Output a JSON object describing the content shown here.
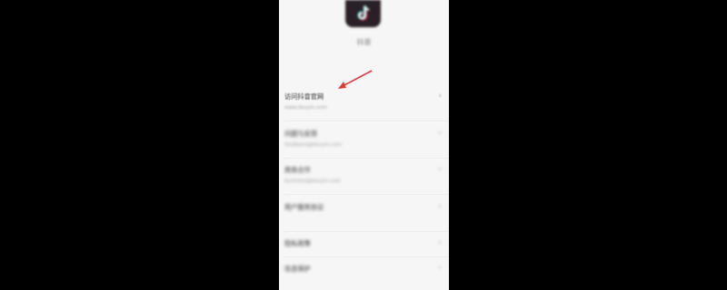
{
  "app": {
    "name": "抖音",
    "logo_icon": "tiktok-note-icon",
    "accent": "#e23a3a"
  },
  "menu": {
    "items": [
      {
        "title": "访问抖音官网",
        "sub": "www.douyin.com",
        "value": "",
        "chevron": "›"
      },
      {
        "title": "问题与反馈",
        "sub": "feedback@douyin.com",
        "value": "",
        "chevron": "›"
      },
      {
        "title": "商务合作",
        "sub": "business@douyin.com",
        "value": "",
        "chevron": "›"
      },
      {
        "title": "用户服务协议",
        "sub": "",
        "value": "",
        "chevron": "›"
      },
      {
        "title": "隐私政策",
        "sub": "",
        "value": "",
        "chevron": "›"
      },
      {
        "title": "信息保护",
        "sub": "",
        "value": "",
        "chevron": "›"
      }
    ]
  }
}
